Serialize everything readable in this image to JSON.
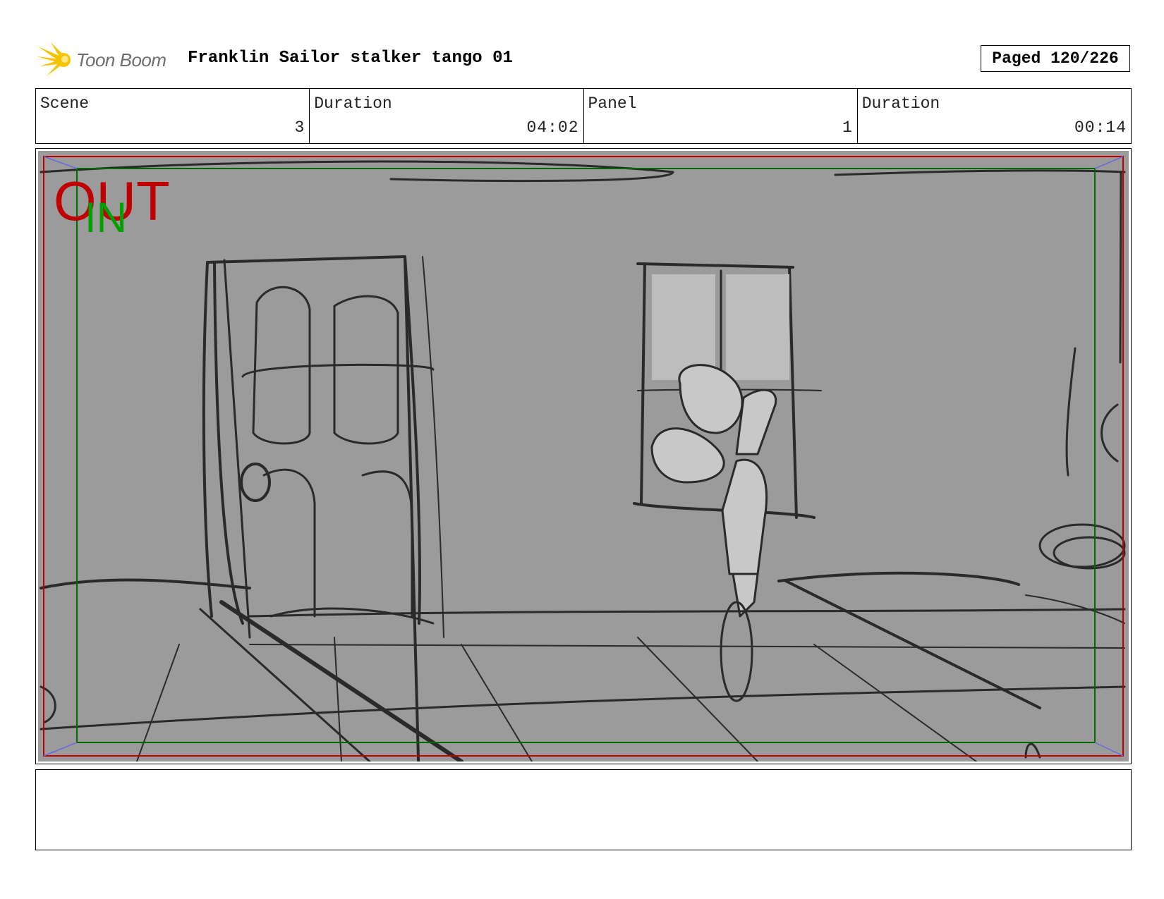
{
  "header": {
    "logo_text": "Toon Boom",
    "title": "Franklin Sailor stalker tango 01",
    "page_counter": "Paged 120/226"
  },
  "info": {
    "scene_label": "Scene",
    "scene_value": "3",
    "scene_duration_label": "Duration",
    "scene_duration_value": "04:02",
    "panel_label": "Panel",
    "panel_value": "1",
    "panel_duration_label": "Duration",
    "panel_duration_value": "00:14"
  },
  "panel": {
    "out_label": "OUT",
    "in_label": "IN",
    "out_color": "#c00000",
    "in_color": "#00a000"
  },
  "notes": {
    "text": ""
  },
  "colors": {
    "logo_star": "#f5c400",
    "frame_background": "#9b9b9b"
  }
}
